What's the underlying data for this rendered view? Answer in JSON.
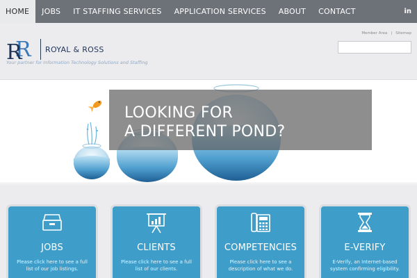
{
  "nav": {
    "items": [
      {
        "label": "HOME",
        "active": true
      },
      {
        "label": "JOBS",
        "active": false
      },
      {
        "label": "IT STAFFING SERVICES",
        "active": false
      },
      {
        "label": "APPLICATION SERVICES",
        "active": false
      },
      {
        "label": "ABOUT",
        "active": false
      },
      {
        "label": "CONTACT",
        "active": false
      }
    ],
    "social_label": "in",
    "social_icon": "linkedin-icon"
  },
  "header": {
    "logo_text": "ROYAL & ROSS",
    "logo_monogram": "RR",
    "tagline": "Your partner for Information Technology Solutions and Staffing",
    "util_links": [
      "Member Area",
      "Sitemap"
    ],
    "util_separator": "|",
    "search": {
      "value": "",
      "placeholder": ""
    }
  },
  "hero": {
    "line1": "LOOKING FOR",
    "line2": "A DIFFERENT POND?"
  },
  "cards": [
    {
      "title": "JOBS",
      "desc": "Please click here to see a full list of our job listings.",
      "icon": "file-drawer-icon"
    },
    {
      "title": "CLIENTS",
      "desc": "Please click here to see a full list of our clients.",
      "icon": "presentation-board-icon"
    },
    {
      "title": "COMPETENCIES",
      "desc": "Please click here to see a description of what we do.",
      "icon": "telephone-icon"
    },
    {
      "title": "E-VERIFY",
      "desc": "E-Verify, an Internet-based system confirming eligibility.",
      "icon": "hourglass-icon"
    }
  ],
  "colors": {
    "nav_bg": "#6d7279",
    "header_bg": "#ececee",
    "card_bg": "#3f9ec9",
    "brand_navy": "#1f3358",
    "brand_blue": "#3d79b8"
  }
}
